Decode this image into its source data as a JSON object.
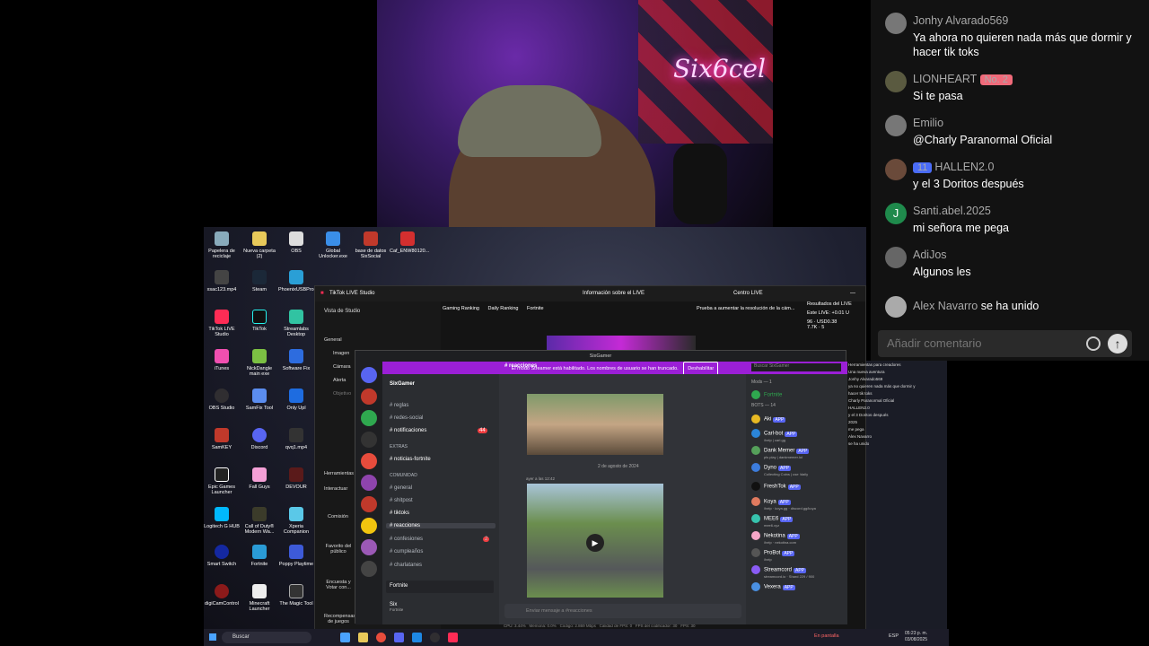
{
  "chat": {
    "messages": [
      {
        "user": "Jonhy Alvarado569",
        "text": "Ya ahora no quieren nada más que dormir y hacer tik toks",
        "avatar_color": "#777"
      },
      {
        "user": "LIONHEART",
        "badge": "No. 2",
        "badge_color": "#f06a7a",
        "text": "Si te pasa",
        "avatar_color": "#5a5a40"
      },
      {
        "user": "Emilio",
        "text": "@Charly Paranormal Oficial",
        "avatar_color": "#777"
      },
      {
        "user": "HALLEN2.0",
        "badge": "11",
        "badge_color": "#4a6cf7",
        "text": "y el 3 Doritos después",
        "avatar_color": "#6a4a3a"
      },
      {
        "user": "Santi.abel.2025",
        "text": "mi señora me pega",
        "avatar_letter": "J",
        "avatar_color": "#1f8a4c"
      },
      {
        "user": "AdiJos",
        "text": "Algunos les",
        "avatar_color": "#666"
      },
      {
        "user": "Alex Navarro",
        "text": "se ha unido",
        "avatar_color": "#aaa"
      }
    ],
    "input_placeholder": "Añadir comentario"
  },
  "webcam": {
    "neon_text": "Six6cel"
  },
  "desktop": {
    "icons": [
      "Papelera de reciclaje",
      "Nueva carpeta (2)",
      "OBS",
      "Global Unlocker.exe",
      "base de datos SixSocial",
      "Caf_ENW80120...",
      "xsac123.mp4",
      "Steam",
      "PhoenixUSBPro...",
      "",
      "TikTok LIVE Studio",
      "TikTok",
      "Streamlabs Desktop",
      "iTunes",
      "NickDangle main exe",
      "Software Fix",
      "OBS Studio",
      "SamFix Tool",
      "Only Upl",
      "SamKEY",
      "Discord",
      "qvq1.mp4",
      "Epic Games Launcher",
      "Fall Guys",
      "DEVOUR",
      "Logitech G HUB",
      "Call of Duty® Modern Wa...",
      "Xperia Companion",
      "Smart Switch",
      "Fortnite",
      "Poppy Playtime",
      "digiCamControl",
      "Minecraft Launcher",
      "The Magic Tool"
    ]
  },
  "tiktok": {
    "title": "TikTok LIVE Studio",
    "center_title": "Información sobre el LIVE",
    "right_button": "Centro LIVE",
    "tabs": [
      "Gaming Ranking",
      "Daily Ranking",
      "Fortnite"
    ],
    "scene_label": "Vista de Studio",
    "general": "General",
    "sources": [
      "Imagen",
      "Cámara",
      "Alerta",
      "Objetivo"
    ],
    "tools_label": "Herramientas",
    "tools": [
      "Interactuar",
      "Comisión",
      "Favorito del público",
      "Encuesta y Votar con...",
      "Recompensas de juegos"
    ],
    "results_title": "Resultados del LIVE",
    "results_line": "Este LIVE: +0.01 U",
    "stats": [
      "96",
      "USD0.38",
      "7.7K",
      "5"
    ],
    "tip": "Prueba a aumentar la resolución de la cám...",
    "status_bar": [
      "CPU: 3.44%",
      "Memoria: 0.0%",
      "Código: 2.869 Mbps",
      "Calidad de FPS: 0",
      "FPS del codificador: 30",
      "FPS: 30"
    ],
    "right_panel": [
      "Herramientas para creadores",
      "Una nueva aventura",
      "Jonhy Alvarado569",
      "ya no quieren nada más que dormir y hacer tik toks",
      "Charly Paranormal Oficial",
      "HALLEN2.0",
      "y el 3 Doritos después",
      "2025",
      "me pega",
      "Alex Navarro",
      "se ha unido"
    ]
  },
  "discord": {
    "window_title": "SixGamer",
    "banner": "El modo Streamer está habilitado. Los nombres de usuario se han truncado.",
    "banner_button": "Deshabilitar",
    "server_name": "SixGamer",
    "channels": [
      {
        "name": "reglas"
      },
      {
        "name": "redes-social"
      },
      {
        "name": "notificaciones",
        "badge": "44"
      },
      {
        "name": "EXTRAS",
        "category": true
      },
      {
        "name": "noticias-fortnite"
      },
      {
        "name": "COMUNIDAD",
        "category": true
      },
      {
        "name": "general"
      },
      {
        "name": "shitpost"
      },
      {
        "name": "tiktoks"
      },
      {
        "name": "reacciones",
        "active": true
      },
      {
        "name": "confesiones",
        "badge": "2"
      },
      {
        "name": "cumpleaños"
      },
      {
        "name": "charlatanes"
      }
    ],
    "voice_status": "Fortnite",
    "user_name": "Six",
    "user_status": "Fortnite",
    "current_channel": "reacciones",
    "search_placeholder": "Buscar SixGamer",
    "date_divider": "2 de agosto de 2024",
    "message_time": "ayer a las 12:42",
    "composer_placeholder": "Enviar mensaje a #reacciones",
    "members_header_mods": "Mods — 1",
    "members_header_bots": "BOTS — 14",
    "members": [
      {
        "name": "Fortnite",
        "color": "#2fa84f"
      },
      {
        "name": "Aki",
        "app": "APP",
        "color": "#e8b923"
      },
      {
        "name": "Carl-bot",
        "app": "APP",
        "sub": "/help | carl.gg",
        "color": "#2b85d8"
      },
      {
        "name": "Dank Memer",
        "app": "APP",
        "sub": "pls play | dankmemer.lol",
        "color": "#55a05a"
      },
      {
        "name": "Dyno",
        "app": "APP",
        "sub": "Collecting Coins | use !daily",
        "color": "#3c7cdc"
      },
      {
        "name": "FreshTok",
        "app": "APP",
        "color": "#111"
      },
      {
        "name": "Koya",
        "app": "APP",
        "sub": "/help · koya.gg · discord.gg/koya",
        "color": "#e07a5f"
      },
      {
        "name": "MEE6",
        "app": "APP",
        "sub": "mee6.xyz",
        "color": "#37c3ae"
      },
      {
        "name": "Nekotina",
        "app": "APP",
        "sub": "/help · nekotina.com",
        "color": "#f5a6c8"
      },
      {
        "name": "ProBot",
        "app": "APP",
        "sub": "/help",
        "color": "#2b2d31"
      },
      {
        "name": "Streamcord",
        "app": "APP",
        "sub": "streamcord.io · Shard 229 / 900",
        "color": "#8a5cf5"
      },
      {
        "name": "Vexera",
        "app": "APP",
        "color": "#4a90e2"
      }
    ]
  },
  "taskbar": {
    "search": "Buscar",
    "status": "En pantalla",
    "lang": "ESP",
    "time": "05:23 p. m.",
    "date": "03/08/2025"
  }
}
